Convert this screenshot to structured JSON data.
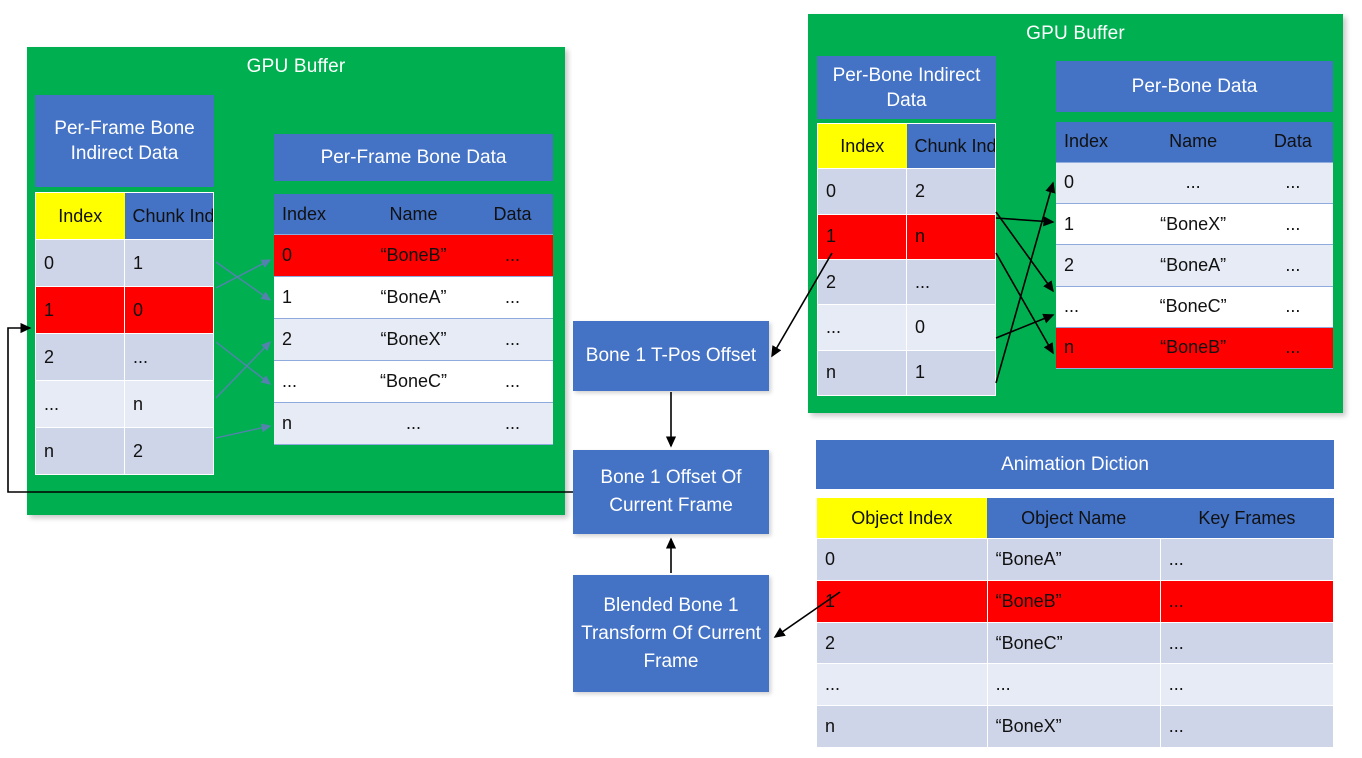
{
  "left_buffer": {
    "title": "GPU Buffer",
    "indirect": {
      "caption": "Per-Frame Bone Indirect Data",
      "headers": [
        "Index",
        "Chunk Index"
      ],
      "rows": [
        {
          "index": "0",
          "chunk": "1",
          "highlight": false
        },
        {
          "index": "1",
          "chunk": "0",
          "highlight": true
        },
        {
          "index": "2",
          "chunk": "...",
          "highlight": false
        },
        {
          "index": "...",
          "chunk": "n",
          "highlight": false
        },
        {
          "index": "n",
          "chunk": "2",
          "highlight": false
        }
      ]
    },
    "data": {
      "caption": "Per-Frame Bone Data",
      "headers": [
        "Index",
        "Name",
        "Data"
      ],
      "rows": [
        {
          "index": "0",
          "name": "“BoneB”",
          "data": "...",
          "highlight": true
        },
        {
          "index": "1",
          "name": "“BoneA”",
          "data": "...",
          "highlight": false
        },
        {
          "index": "2",
          "name": "“BoneX”",
          "data": "...",
          "highlight": false
        },
        {
          "index": "...",
          "name": "“BoneC”",
          "data": "...",
          "highlight": false
        },
        {
          "index": "n",
          "name": "...",
          "data": "...",
          "highlight": false
        }
      ]
    }
  },
  "right_buffer": {
    "title": "GPU Buffer",
    "indirect": {
      "caption": "Per-Bone Indirect Data",
      "headers": [
        "Index",
        "Chunk Index"
      ],
      "rows": [
        {
          "index": "0",
          "chunk": "2",
          "highlight": false
        },
        {
          "index": "1",
          "chunk": "n",
          "highlight": true
        },
        {
          "index": "2",
          "chunk": "...",
          "highlight": false
        },
        {
          "index": "...",
          "chunk": "0",
          "highlight": false
        },
        {
          "index": "n",
          "chunk": "1",
          "highlight": false
        }
      ]
    },
    "data": {
      "caption": "Per-Bone Data",
      "headers": [
        "Index",
        "Name",
        "Data"
      ],
      "rows": [
        {
          "index": "0",
          "name": "...",
          "data": "...",
          "highlight": false
        },
        {
          "index": "1",
          "name": "“BoneX”",
          "data": "...",
          "highlight": false
        },
        {
          "index": "2",
          "name": "“BoneA”",
          "data": "...",
          "highlight": false
        },
        {
          "index": "...",
          "name": "“BoneC”",
          "data": "...",
          "highlight": false
        },
        {
          "index": "n",
          "name": "“BoneB”",
          "data": "...",
          "highlight": true
        }
      ]
    }
  },
  "animation_diction": {
    "caption": "Animation Diction",
    "headers": [
      "Object Index",
      "Object Name",
      "Key Frames"
    ],
    "rows": [
      {
        "index": "0",
        "name": "“BoneA”",
        "keys": "...",
        "highlight": false
      },
      {
        "index": "1",
        "name": "“BoneB”",
        "keys": "...",
        "highlight": true
      },
      {
        "index": "2",
        "name": "“BoneC”",
        "keys": "...",
        "highlight": false
      },
      {
        "index": "...",
        "name": "...",
        "keys": "...",
        "highlight": false
      },
      {
        "index": "n",
        "name": "“BoneX”",
        "keys": "...",
        "highlight": false
      }
    ]
  },
  "flow": {
    "t_pos": "Bone 1 T-Pos Offset",
    "offset_current": "Bone 1 Offset Of Current Frame",
    "blended": "Blended Bone 1 Transform Of Current Frame"
  },
  "colors": {
    "green": "#00B050",
    "blue": "#4472C4",
    "yellow": "#FFFF00",
    "red": "#FF0000",
    "band": "#CFD5E9",
    "band_light": "#E7EBF5",
    "grid_blue": "#8FAADC",
    "arrow_left": "#5A7FB5",
    "arrow_right": "#000000"
  }
}
